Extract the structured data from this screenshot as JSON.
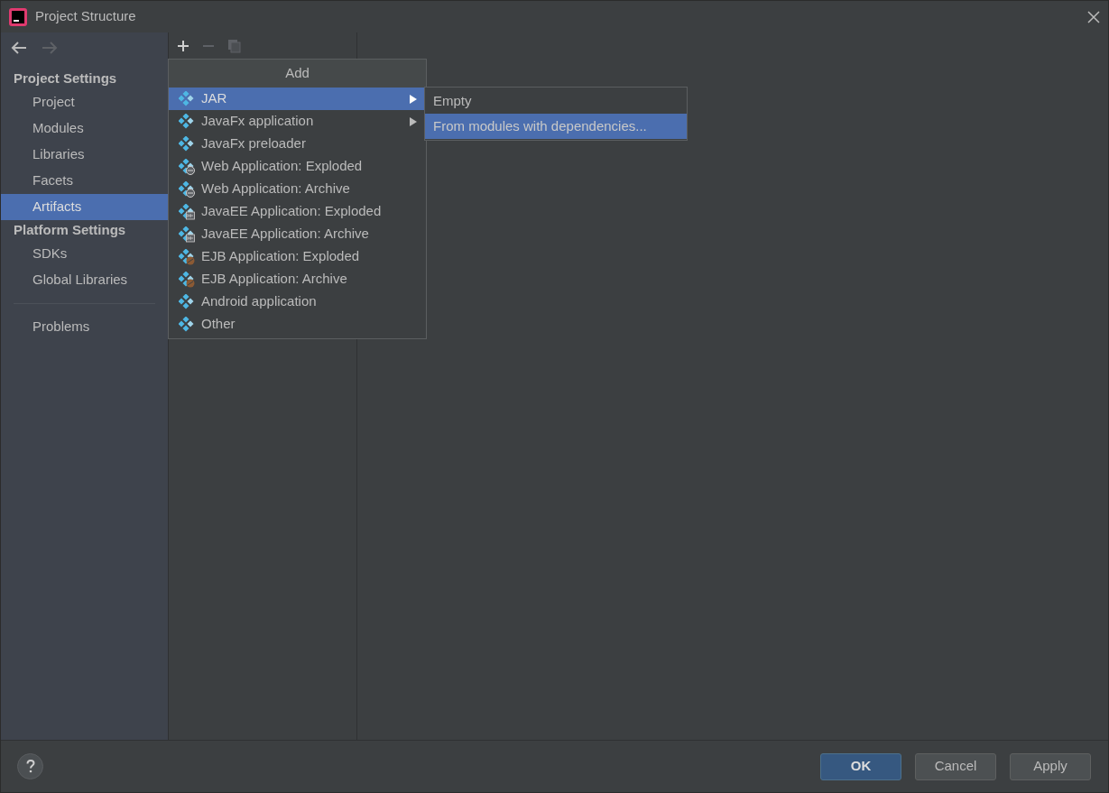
{
  "window": {
    "title": "Project Structure"
  },
  "sidebar": {
    "sections": [
      {
        "heading": "Project Settings",
        "items": [
          {
            "label": "Project",
            "selected": false
          },
          {
            "label": "Modules",
            "selected": false
          },
          {
            "label": "Libraries",
            "selected": false
          },
          {
            "label": "Facets",
            "selected": false
          },
          {
            "label": "Artifacts",
            "selected": true
          }
        ]
      },
      {
        "heading": "Platform Settings",
        "items": [
          {
            "label": "SDKs",
            "selected": false
          },
          {
            "label": "Global Libraries",
            "selected": false
          }
        ]
      }
    ],
    "footer_items": [
      {
        "label": "Problems",
        "selected": false
      }
    ]
  },
  "add_menu": {
    "title": "Add",
    "items": [
      {
        "label": "JAR",
        "kind": "plain",
        "submenu": true,
        "selected": true
      },
      {
        "label": "JavaFx application",
        "kind": "plain",
        "submenu": true,
        "selected": false
      },
      {
        "label": "JavaFx preloader",
        "kind": "plain",
        "submenu": false,
        "selected": false
      },
      {
        "label": "Web Application: Exploded",
        "kind": "web",
        "submenu": false,
        "selected": false
      },
      {
        "label": "Web Application: Archive",
        "kind": "web",
        "submenu": false,
        "selected": false
      },
      {
        "label": "JavaEE Application: Exploded",
        "kind": "javaee",
        "submenu": false,
        "selected": false
      },
      {
        "label": "JavaEE Application: Archive",
        "kind": "javaee",
        "submenu": false,
        "selected": false
      },
      {
        "label": "EJB Application: Exploded",
        "kind": "ejb",
        "submenu": false,
        "selected": false
      },
      {
        "label": "EJB Application: Archive",
        "kind": "ejb",
        "submenu": false,
        "selected": false
      },
      {
        "label": "Android application",
        "kind": "plain",
        "submenu": false,
        "selected": false
      },
      {
        "label": "Other",
        "kind": "plain",
        "submenu": false,
        "selected": false
      }
    ]
  },
  "submenu": {
    "items": [
      {
        "label": "Empty",
        "selected": false
      },
      {
        "label": "From modules with dependencies...",
        "selected": true
      }
    ]
  },
  "buttons": [
    {
      "label": "OK",
      "kind": "primary"
    },
    {
      "label": "Cancel",
      "kind": "normal"
    },
    {
      "label": "Apply",
      "kind": "normal"
    }
  ]
}
